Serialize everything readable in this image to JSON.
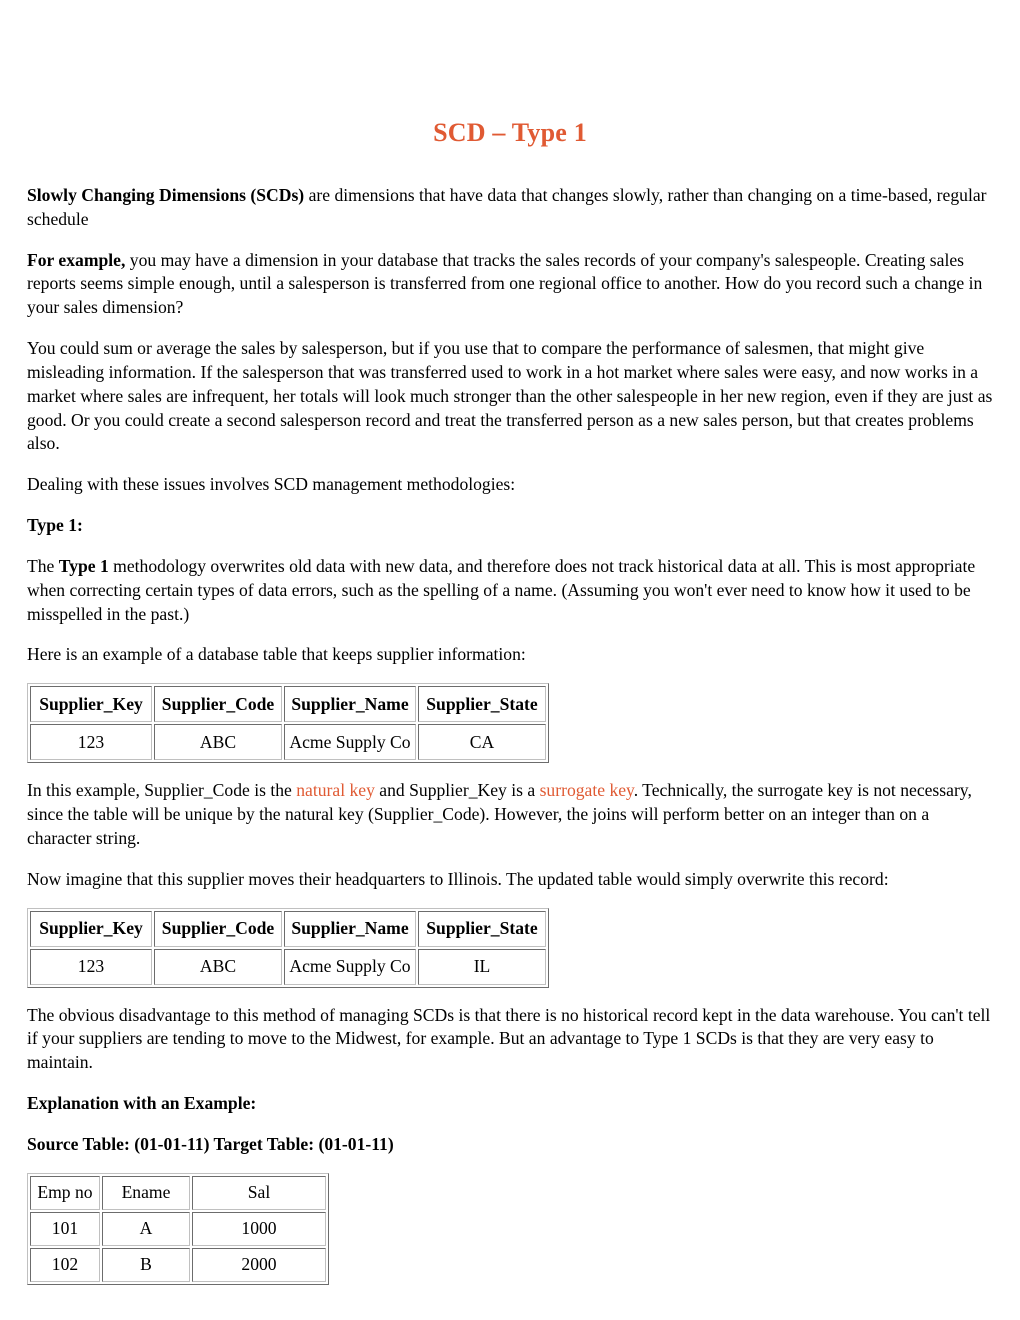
{
  "document": {
    "title": "SCD – Type 1",
    "title_color": "#e05a33",
    "accent_color": "#e05a33"
  },
  "paragraphs": {
    "p1_bold": "Slowly Changing Dimensions (SCDs)",
    "p1_rest": " are dimensions that have data that changes slowly, rather than changing on a time-based, regular schedule",
    "p2_bold": "For example,",
    "p2_rest": " you may have a dimension in your database that tracks the sales records of your company's salespeople. Creating sales reports seems simple enough, until a salesperson is transferred from one regional office to another. How do you record such a change in your sales dimension?",
    "p3": "You could sum or average the sales by salesperson, but if you use that to compare the performance of salesmen, that might give misleading information. If the salesperson that was transferred used to work in a hot market where sales were easy, and now works in a market where sales are infrequent, her totals will look much stronger than the other salespeople in her new region, even if they are just as good. Or you could create a second salesperson record and treat the transferred person as a new sales person, but that creates problems also.",
    "p4": "Dealing with these issues involves SCD management methodologies:",
    "heading_type1": "Type 1:",
    "p5_a": "The ",
    "p5_bold": "Type 1",
    "p5_b": " methodology overwrites old data with new data, and therefore does not track historical data at all. This is most appropriate when correcting certain types of data errors, such as the spelling of a name. (Assuming you won't ever need to know how it used to be misspelled in the past.)",
    "p6": "Here is an example of a database table that keeps supplier information:",
    "p7_a": "In this example, Supplier_Code is the ",
    "p7_accent1": "natural key",
    "p7_b": " and Supplier_Key is a ",
    "p7_accent2": "surrogate key",
    "p7_c": ". Technically, the surrogate key is not necessary, since the table will be unique by the natural key (Supplier_Code). However, the joins will perform better on an integer than on a character string.",
    "p8": "Now imagine that this supplier moves their headquarters to Illinois. The updated table would simply overwrite this record:",
    "p9": "The obvious disadvantage to this method of managing SCDs is that there is no historical record kept in the data warehouse. You can't tell if your suppliers are tending to move to the Midwest, for example. But an advantage to Type 1 SCDs is that they are very easy to maintain.",
    "heading_explanation": "Explanation with an Example:",
    "heading_source_target": "Source Table: (01-01-11) Target Table: (01-01-11)"
  },
  "tables": {
    "supplier_before": {
      "headers": [
        "Supplier_Key",
        "Supplier_Code",
        "Supplier_Name",
        "Supplier_State"
      ],
      "rows": [
        [
          "123",
          "ABC",
          "Acme Supply Co",
          "CA"
        ]
      ]
    },
    "supplier_after": {
      "headers": [
        "Supplier_Key",
        "Supplier_Code",
        "Supplier_Name",
        "Supplier_State"
      ],
      "rows": [
        [
          "123",
          "ABC",
          "Acme Supply Co",
          "IL"
        ]
      ]
    },
    "employee": {
      "headers": [
        "Emp no",
        "Ename",
        "Sal"
      ],
      "rows": [
        [
          "101",
          "A",
          "1000"
        ],
        [
          "102",
          "B",
          "2000"
        ]
      ]
    }
  }
}
